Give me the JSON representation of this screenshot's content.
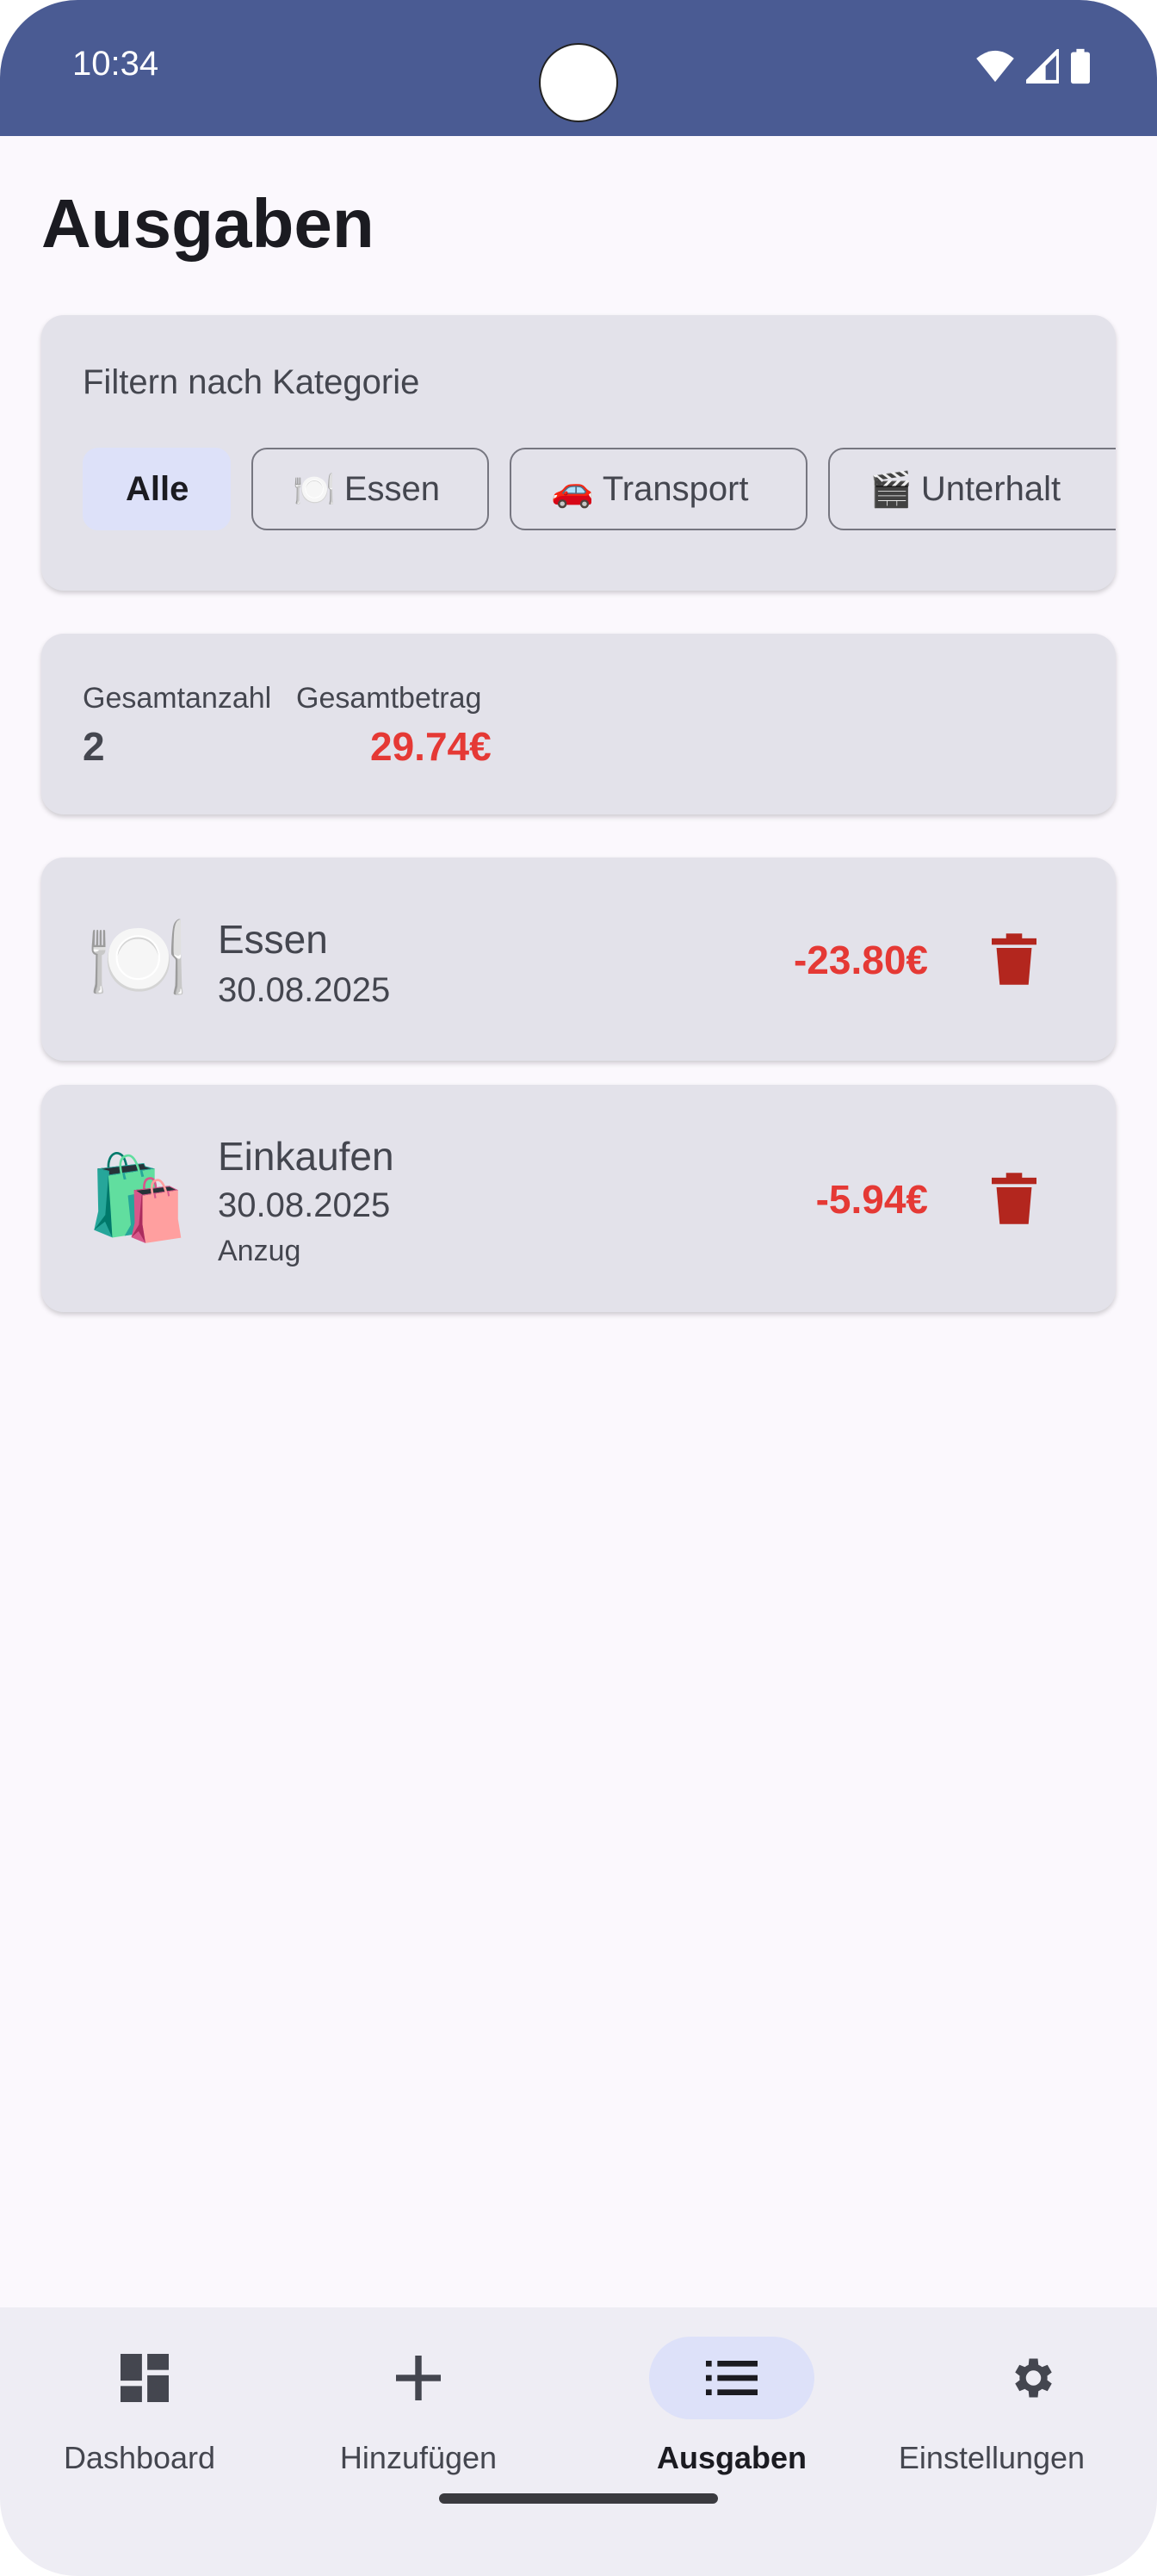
{
  "status_bar": {
    "time": "10:34"
  },
  "page": {
    "title": "Ausgaben"
  },
  "filter": {
    "label": "Filtern nach Kategorie",
    "chips": [
      {
        "label": "Alle",
        "selected": true
      },
      {
        "emoji": "🍽️",
        "label": "Essen",
        "selected": false
      },
      {
        "emoji": "🚗",
        "label": "Transport",
        "selected": false
      },
      {
        "emoji": "🎬",
        "label": "Unterhalt",
        "selected": false
      }
    ]
  },
  "summary": {
    "count_label": "Gesamtanzahl",
    "total_label": "Gesamtbetrag",
    "count": "2",
    "total": "29.74€"
  },
  "expenses": [
    {
      "icon": "🍽️",
      "category": "Essen",
      "date": "30.08.2025",
      "note": "",
      "amount": "-23.80€"
    },
    {
      "icon": "🛍️",
      "category": "Einkaufen",
      "date": "30.08.2025",
      "note": "Anzug",
      "amount": "-5.94€"
    }
  ],
  "bottom_nav": {
    "items": [
      {
        "label": "Dashboard",
        "icon": "dashboard-icon",
        "active": false
      },
      {
        "label": "Hinzufügen",
        "icon": "plus-icon",
        "active": false
      },
      {
        "label": "Ausgaben",
        "icon": "list-icon",
        "active": true
      },
      {
        "label": "Einstellungen",
        "icon": "gear-icon",
        "active": false
      }
    ]
  },
  "colors": {
    "status_bar": "#4a5b93",
    "card": "#e3e2ea",
    "amount": "#e53935",
    "delete": "#b3261e",
    "selected_chip": "#dde1f9"
  }
}
